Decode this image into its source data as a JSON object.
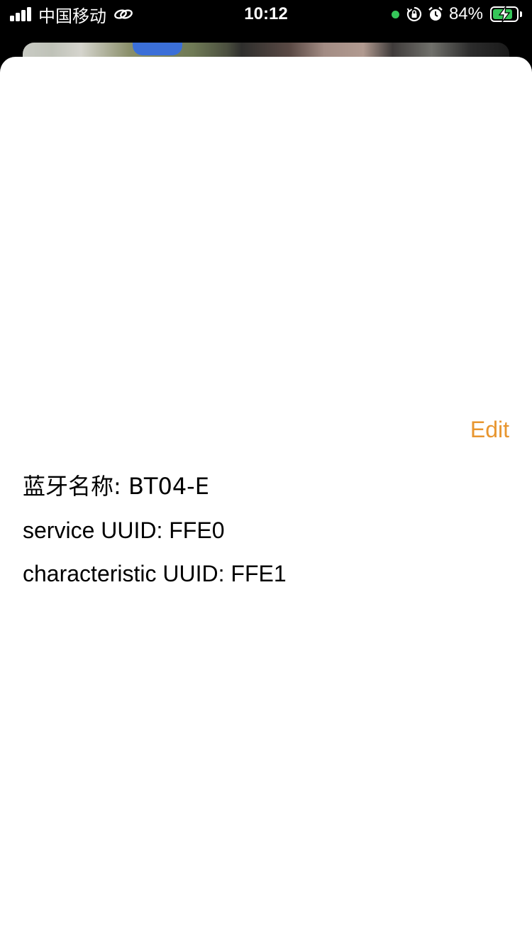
{
  "status_bar": {
    "carrier": "中国移动",
    "time": "10:12",
    "battery_percent": "84%",
    "battery_level": 0.84,
    "icons": [
      "signal-icon",
      "link-icon",
      "green-dot-indicator",
      "orientation-lock-icon",
      "alarm-icon",
      "battery-charging-icon"
    ],
    "accent_green": "#35c759"
  },
  "sheet": {
    "edit_label": "Edit",
    "edit_color": "#e8962f",
    "bluetooth_name_label": "蓝牙名称: BT04-E",
    "service_uuid_label": "service UUID: FFE0",
    "characteristic_uuid_label": "characteristic UUID: FFE1"
  }
}
